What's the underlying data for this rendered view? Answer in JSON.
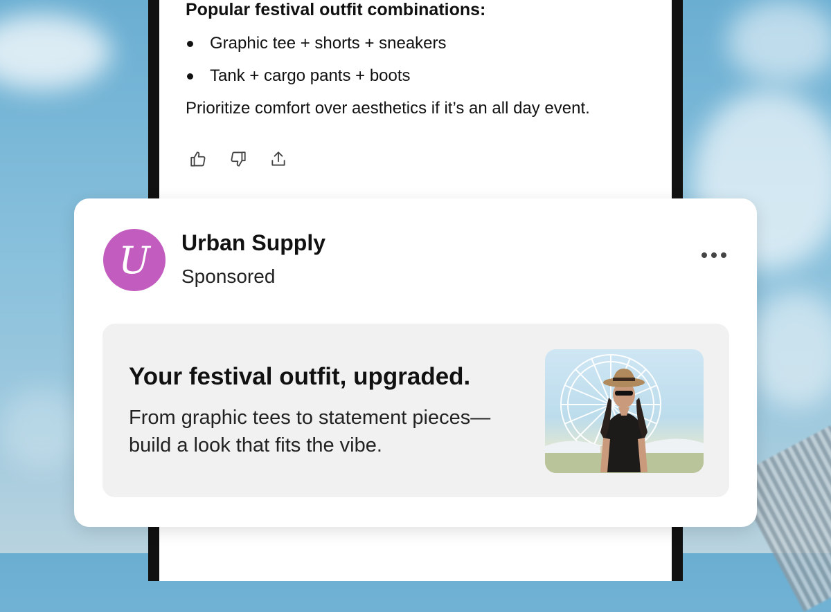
{
  "chat": {
    "heading": "Popular festival outfit combinations:",
    "bullets": [
      "Graphic tee + shorts + sneakers",
      "Tank + cargo pants + boots"
    ],
    "note": "Prioritize comfort over aesthetics if it’s an all day event.",
    "actions": [
      "thumbs-up-icon",
      "thumbs-down-icon",
      "share-icon"
    ]
  },
  "ad": {
    "brand": "Urban Supply",
    "avatar_letter": "U",
    "avatar_color": "#c35cbf",
    "label": "Sponsored",
    "headline": "Your festival outfit, upgraded.",
    "body": "From graphic tees to statement pieces—build a look that fits the vibe.",
    "more_icon": "more-options-icon"
  },
  "colors": {
    "sky": "#88c0dc",
    "card_bg": "#ffffff",
    "ad_box_bg": "#f1f1f1"
  }
}
